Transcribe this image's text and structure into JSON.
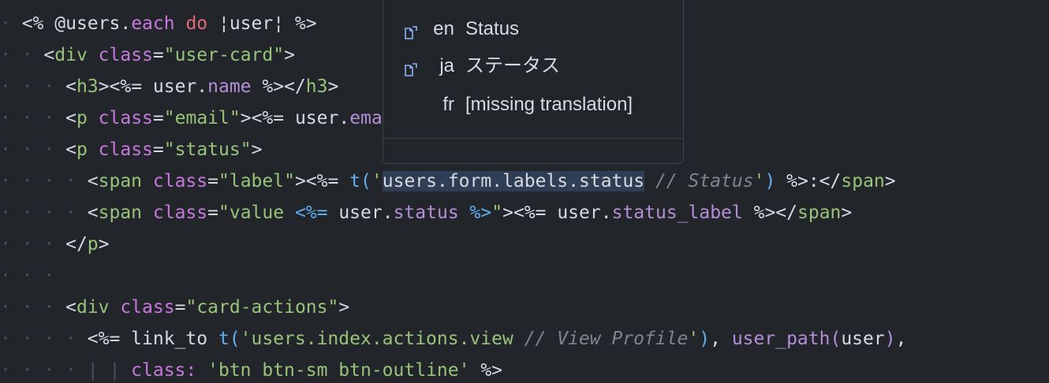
{
  "code_lines": [
    {
      "parts": [
        [
          "ws",
          "· "
        ],
        [
          "p",
          "<% @users."
        ],
        [
          "m",
          "each"
        ],
        [
          "p",
          " "
        ],
        [
          "k",
          "do"
        ],
        [
          "p",
          " ¦user¦ %>"
        ]
      ]
    },
    {
      "parts": [
        [
          "ws",
          "· · "
        ],
        [
          "p",
          "<"
        ],
        [
          "tg",
          "div"
        ],
        [
          "p",
          " "
        ],
        [
          "m",
          "class"
        ],
        [
          "p",
          "="
        ],
        [
          "s",
          "\"user-card\""
        ],
        [
          "p",
          ">"
        ]
      ]
    },
    {
      "parts": [
        [
          "ws",
          "· · · "
        ],
        [
          "p",
          "<"
        ],
        [
          "tg",
          "h3"
        ],
        [
          "p",
          "><%= user."
        ],
        [
          "mt",
          "name"
        ],
        [
          "p",
          " %></"
        ],
        [
          "tg",
          "h3"
        ],
        [
          "p",
          ">"
        ]
      ]
    },
    {
      "parts": [
        [
          "ws",
          "· · · "
        ],
        [
          "p",
          "<"
        ],
        [
          "tg",
          "p"
        ],
        [
          "p",
          " "
        ],
        [
          "m",
          "class"
        ],
        [
          "p",
          "="
        ],
        [
          "s",
          "\"email\""
        ],
        [
          "p",
          "><%= user."
        ],
        [
          "mt",
          "ema"
        ]
      ]
    },
    {
      "parts": [
        [
          "ws",
          "· · · "
        ],
        [
          "p",
          "<"
        ],
        [
          "tg",
          "p"
        ],
        [
          "p",
          " "
        ],
        [
          "m",
          "class"
        ],
        [
          "p",
          "="
        ],
        [
          "s",
          "\"status\""
        ],
        [
          "p",
          ">"
        ]
      ]
    },
    {
      "parts": [
        [
          "ws",
          "· · · · "
        ],
        [
          "p",
          "<"
        ],
        [
          "tg",
          "span"
        ],
        [
          "p",
          " "
        ],
        [
          "m",
          "class"
        ],
        [
          "p",
          "="
        ],
        [
          "s",
          "\"label\""
        ],
        [
          "p",
          "><%= "
        ],
        [
          "fn",
          "t("
        ],
        [
          "s",
          "'"
        ],
        [
          "hl",
          "users.form.labels.status"
        ],
        [
          "p",
          " "
        ],
        [
          "cm",
          "// Status"
        ],
        [
          "s",
          "'"
        ],
        [
          "fn",
          ")"
        ],
        [
          "p",
          " %>:</"
        ],
        [
          "tg",
          "span"
        ],
        [
          "p",
          ">"
        ]
      ]
    },
    {
      "parts": [
        [
          "ws",
          "· · · · "
        ],
        [
          "p",
          "<"
        ],
        [
          "tg",
          "span"
        ],
        [
          "p",
          " "
        ],
        [
          "m",
          "class"
        ],
        [
          "p",
          "="
        ],
        [
          "s",
          "\"value "
        ],
        [
          "fn",
          "<%="
        ],
        [
          "p",
          " user."
        ],
        [
          "mt",
          "status"
        ],
        [
          "p",
          " "
        ],
        [
          "fn",
          "%>"
        ],
        [
          "s",
          "\""
        ],
        [
          "p",
          "><%= user."
        ],
        [
          "mt",
          "status_label"
        ],
        [
          "p",
          " %></"
        ],
        [
          "tg",
          "span"
        ],
        [
          "p",
          ">"
        ]
      ]
    },
    {
      "parts": [
        [
          "ws",
          "· · · "
        ],
        [
          "p",
          "</"
        ],
        [
          "tg",
          "p"
        ],
        [
          "p",
          ">"
        ]
      ]
    },
    {
      "parts": [
        [
          "ws",
          "· · · "
        ]
      ]
    },
    {
      "parts": [
        [
          "ws",
          "· · · "
        ],
        [
          "p",
          "<"
        ],
        [
          "tg",
          "div"
        ],
        [
          "p",
          " "
        ],
        [
          "m",
          "class"
        ],
        [
          "p",
          "="
        ],
        [
          "s",
          "\"card-actions\""
        ],
        [
          "p",
          ">"
        ]
      ]
    },
    {
      "parts": [
        [
          "ws",
          "· · · · "
        ],
        [
          "p",
          "<%= link_to "
        ],
        [
          "fn",
          "t("
        ],
        [
          "s",
          "'users.index.actions.view "
        ],
        [
          "cm",
          "// View Profile"
        ],
        [
          "s",
          "'"
        ],
        [
          "fn",
          ")"
        ],
        [
          "p",
          ", "
        ],
        [
          "mt",
          "user_path("
        ],
        [
          "p",
          "user"
        ],
        [
          "mt",
          ")"
        ],
        [
          "p",
          ","
        ]
      ]
    },
    {
      "parts": [
        [
          "ws",
          "· · · · | | "
        ],
        [
          "m",
          "class:"
        ],
        [
          "p",
          " "
        ],
        [
          "s",
          "'btn btn-sm btn-outline'"
        ],
        [
          "p",
          " %>"
        ]
      ]
    }
  ],
  "popup": {
    "translations": [
      {
        "icon": "document-link-icon",
        "lang": "en",
        "text": "Status"
      },
      {
        "icon": "document-link-icon",
        "lang": "ja",
        "text": "ステータス"
      },
      {
        "icon": "",
        "lang": "fr",
        "text": "[missing translation]"
      }
    ]
  },
  "colors": {
    "background": "#22252a",
    "popup_border": "#3d4148",
    "icon": "#8ab4f8"
  }
}
